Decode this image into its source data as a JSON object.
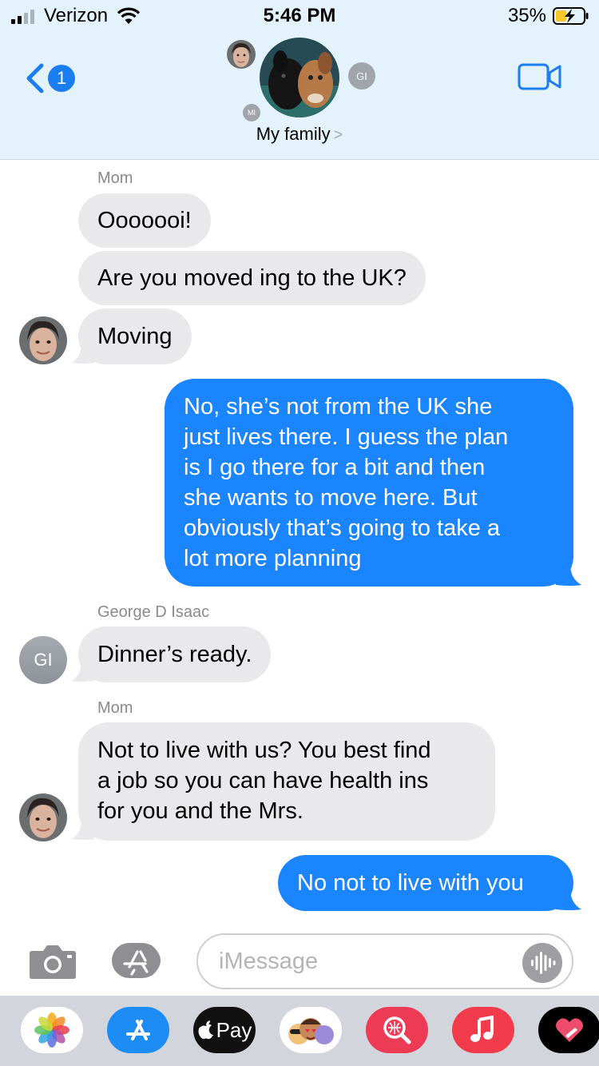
{
  "status_bar": {
    "carrier": "Verizon",
    "time": "5:46 PM",
    "battery": "35%"
  },
  "header": {
    "back_badge": "1",
    "group_name": "My family",
    "chevron": ">",
    "member_initials": [
      "GI",
      "MI"
    ]
  },
  "messages": [
    {
      "sender": "Mom"
    },
    {
      "text": "Ooooooi!",
      "direction": "incoming"
    },
    {
      "text": "Are you moved ing to the UK?",
      "direction": "incoming"
    },
    {
      "text": "Moving",
      "direction": "incoming"
    },
    {
      "lines": [
        "No, she’s not from the UK she",
        "just lives there. I guess the plan",
        "is I go there for a bit and then",
        "she wants to move here. But",
        "obviously that’s going to take a",
        "lot more planning"
      ],
      "direction": "outgoing"
    },
    {
      "sender": "George D Isaac"
    },
    {
      "text": "Dinner’s ready.",
      "direction": "incoming",
      "avatar": "GI"
    },
    {
      "sender": "Mom"
    },
    {
      "lines": [
        "Not to live with us? You best find",
        "a job so you can have health ins",
        "for you and the Mrs."
      ],
      "direction": "incoming"
    },
    {
      "text": "No not to live with you",
      "direction": "outgoing"
    }
  ],
  "input": {
    "placeholder": "iMessage"
  },
  "app_drawer": {
    "apps": [
      "photos-app-icon",
      "app-store-icon",
      "apple-pay-icon",
      "memoji-icon",
      "web-search-icon",
      "music-icon",
      "digital-touch-icon"
    ],
    "pay_label": "Pay"
  },
  "colors": {
    "header_bg": "#e3f2fb",
    "incoming_bubble": "#e9e9eb",
    "outgoing_bubble": "#1b84ff",
    "accent": "#1b7ef0"
  }
}
